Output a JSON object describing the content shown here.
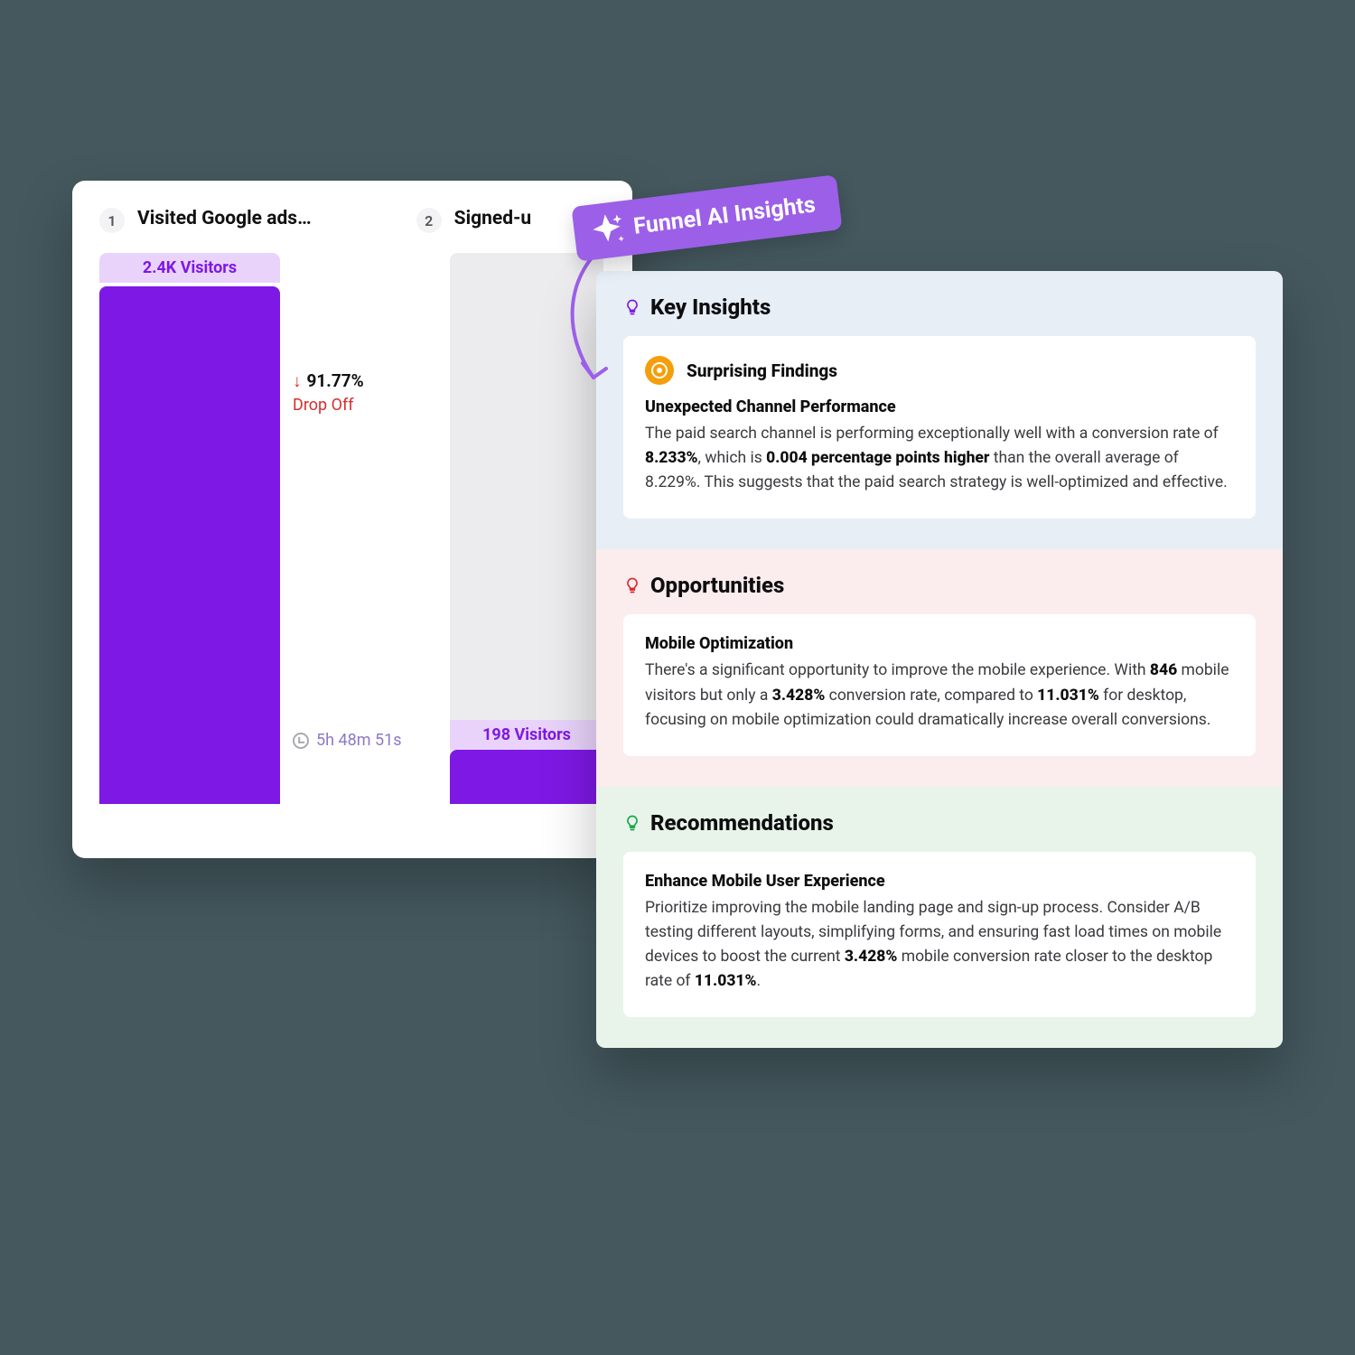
{
  "funnel": {
    "steps": [
      {
        "index": "1",
        "label": "Visited Google ads…"
      },
      {
        "index": "2",
        "label": "Signed-u"
      }
    ],
    "bars": [
      {
        "visitors": "2.4K Visitors",
        "fill_pct": 94
      },
      {
        "visitors": "198 Visitors",
        "fill_pct": 9
      }
    ],
    "dropoff": {
      "arrow": "↓",
      "pct": "91.77%",
      "label": "Drop Off"
    },
    "timing": "5h 48m 51s"
  },
  "banner": "Funnel AI Insights",
  "insights": {
    "key": {
      "title": "Key Insights",
      "findings_label": "Surprising Findings",
      "card": {
        "heading": "Unexpected Channel Performance",
        "pre": "The paid search channel is performing exceptionally well with a conversion rate of ",
        "b1": "8.233%",
        "mid1": ", which is ",
        "b2": "0.004 percentage points higher",
        "post": " than the overall average of 8.229%. This suggests that the paid search strategy is well-optimized and effective."
      }
    },
    "opp": {
      "title": "Opportunities",
      "card": {
        "heading": "Mobile Optimization",
        "pre": "There's a significant opportunity to improve the mobile experience. With ",
        "b1": "846",
        "mid1": " mobile visitors but only a ",
        "b2": "3.428%",
        "mid2": " conversion rate, compared to ",
        "b3": "11.031%",
        "post": " for desktop, focusing on mobile optimization could dramatically increase overall conversions."
      }
    },
    "rec": {
      "title": "Recommendations",
      "card": {
        "heading": "Enhance Mobile User Experience",
        "pre": "Prioritize improving the mobile landing page and sign-up process. Consider A/B testing different layouts, simplifying forms, and ensuring fast load times on mobile devices to boost the current ",
        "b1": "3.428%",
        "mid1": " mobile conversion rate closer to the desktop rate of ",
        "b2": "11.031%",
        "post": "."
      }
    }
  },
  "chart_data": {
    "type": "bar",
    "title": "Funnel steps",
    "categories": [
      "Visited Google ads…",
      "Signed-up"
    ],
    "values": [
      2400,
      198
    ],
    "value_labels": [
      "2.4K Visitors",
      "198 Visitors"
    ],
    "dropoff_pct": 91.77,
    "avg_time_between_steps": "5h 48m 51s"
  }
}
